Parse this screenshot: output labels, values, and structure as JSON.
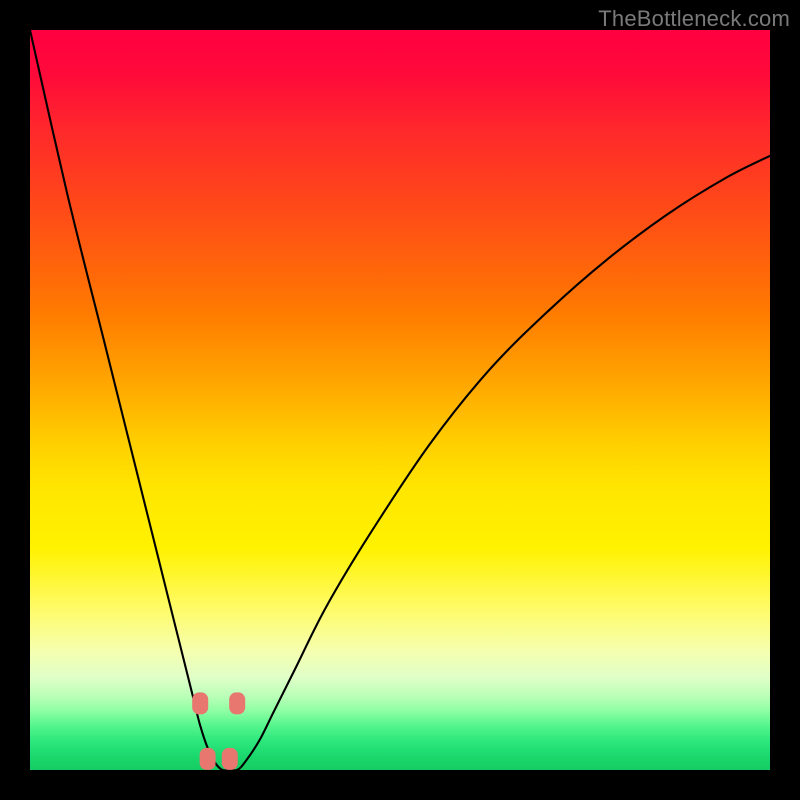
{
  "watermark": "TheBottleneck.com",
  "chart_data": {
    "type": "line",
    "title": "",
    "xlabel": "",
    "ylabel": "",
    "xlim": [
      0,
      100
    ],
    "ylim": [
      0,
      100
    ],
    "series": [
      {
        "name": "bottleneck-curve",
        "x": [
          0,
          5,
          10,
          13,
          16,
          18,
          20,
          22,
          23,
          24,
          25,
          26,
          27,
          28,
          29,
          31,
          33,
          36,
          40,
          46,
          54,
          62,
          70,
          78,
          86,
          94,
          100
        ],
        "values": [
          100,
          78,
          58,
          46,
          34,
          26,
          18,
          10,
          6,
          3,
          1,
          0,
          0,
          0,
          1,
          4,
          8,
          14,
          22,
          32,
          44,
          54,
          62,
          69,
          75,
          80,
          83
        ]
      }
    ],
    "markers": {
      "name": "valley-points",
      "shape": "rounded-rect",
      "color": "#e7776f",
      "points": [
        {
          "x": 23.0,
          "y": 9.0
        },
        {
          "x": 28.0,
          "y": 9.0
        },
        {
          "x": 24.0,
          "y": 1.5
        },
        {
          "x": 27.0,
          "y": 1.5
        }
      ]
    }
  }
}
